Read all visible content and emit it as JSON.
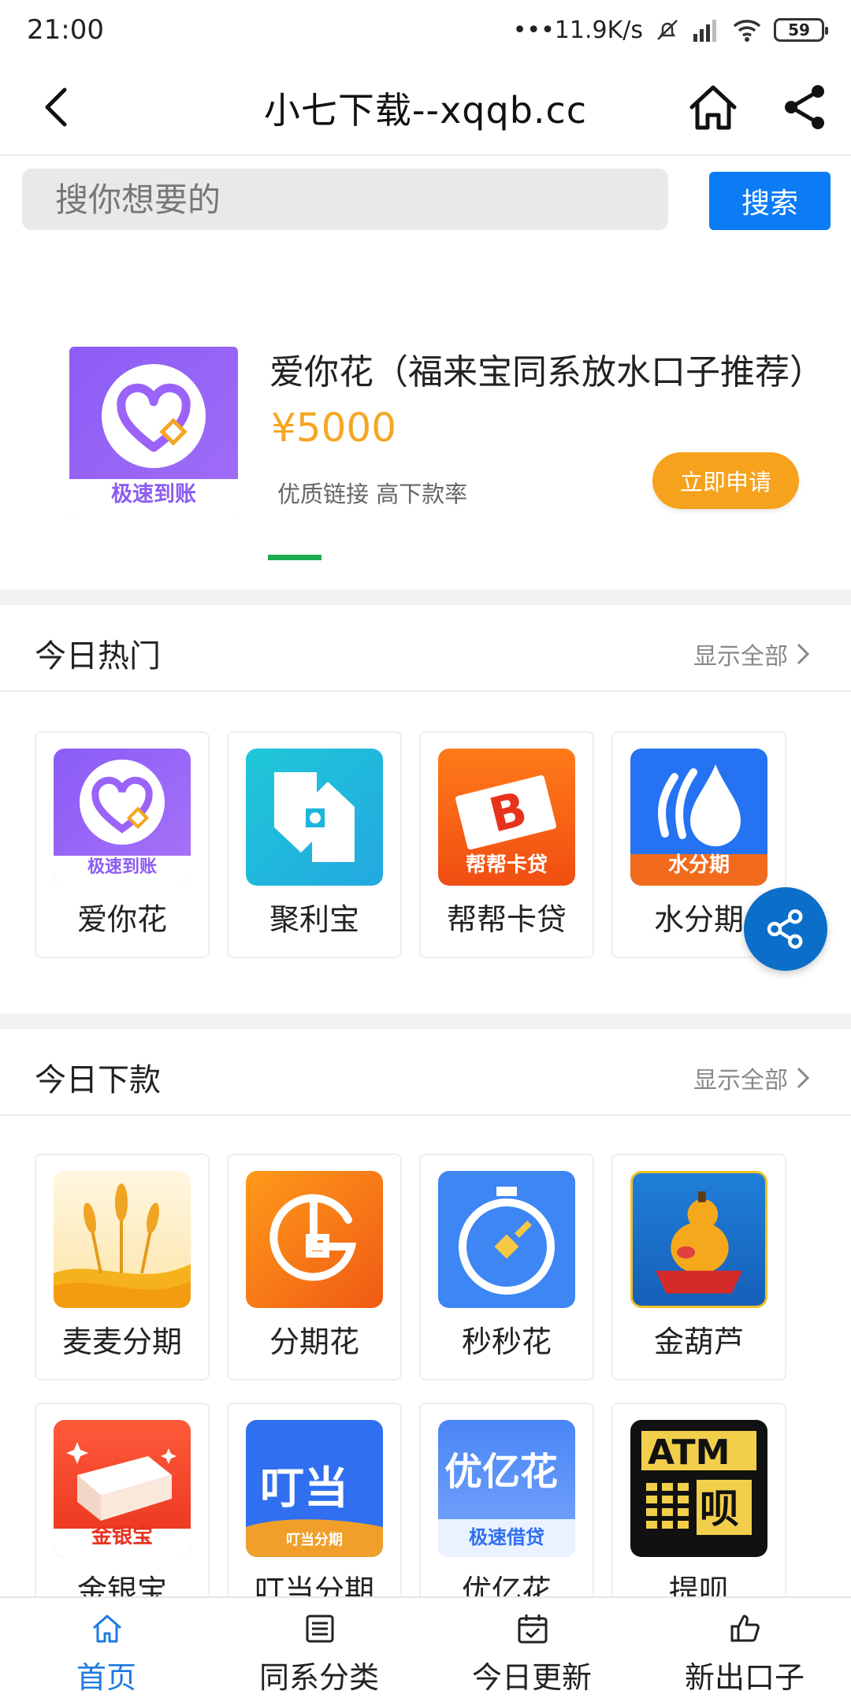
{
  "status_bar": {
    "time": "21:00",
    "network_speed": "•••11.9K/s",
    "battery": "59"
  },
  "navbar": {
    "title": "小七下载--xqqb.cc"
  },
  "search": {
    "placeholder": "搜你想要的",
    "button_label": "搜索"
  },
  "banner": {
    "title": "爱你花（福来宝同系放水口子推荐）",
    "amount": "¥5000",
    "description": "优质链接 高下款率",
    "apply_label": "立即申请",
    "logo_caption": "极速到账"
  },
  "hot_section": {
    "title": "今日热门",
    "more_label": "显示全部",
    "items": [
      {
        "label": "爱你花",
        "caption": "极速到账"
      },
      {
        "label": "聚利宝"
      },
      {
        "label": "帮帮卡贷",
        "caption": "帮帮卡贷"
      },
      {
        "label": "水分期",
        "caption": "水分期"
      }
    ]
  },
  "loan_section": {
    "title": "今日下款",
    "more_label": "显示全部",
    "items": [
      {
        "label": "麦麦分期"
      },
      {
        "label": "分期花"
      },
      {
        "label": "秒秒花"
      },
      {
        "label": "金葫芦"
      },
      {
        "label": "金银宝",
        "caption": "金银宝"
      },
      {
        "label": "叮当分期",
        "caption": "叮当分期",
        "logo_text": "叮当"
      },
      {
        "label": "优亿花",
        "caption": "极速借贷",
        "logo_text": "优亿花"
      },
      {
        "label": "提呗",
        "logo_text": "ATM",
        "logo_text2": "呗"
      }
    ]
  },
  "tabbar": {
    "tabs": [
      {
        "label": "首页",
        "icon": "home-icon"
      },
      {
        "label": "同系分类",
        "icon": "list-icon"
      },
      {
        "label": "今日更新",
        "icon": "calendar-check-icon"
      },
      {
        "label": "新出口子",
        "icon": "thumbs-up-icon"
      }
    ]
  },
  "colors": {
    "accent_blue": "#0b7cf6",
    "active_tab": "#1f7ae0",
    "amount_orange": "#f5a623",
    "indicator_green": "#1daa4f"
  }
}
